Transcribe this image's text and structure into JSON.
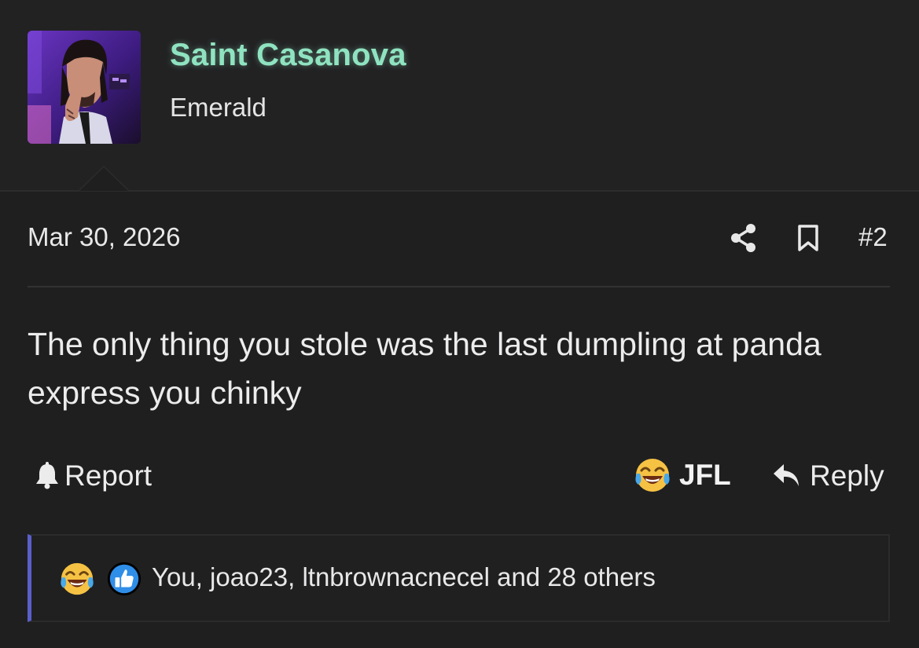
{
  "post": {
    "author": {
      "username": "Saint Casanova",
      "title": "Emerald",
      "username_color": "#8fe3c0"
    },
    "date": "Mar 30, 2026",
    "number": "#2",
    "message": "The only thing you stole was the last dumpling at panda express you chinky",
    "actions": {
      "report_label": "Report",
      "reaction_label": "JFL",
      "reply_label": "Reply"
    },
    "reactions": {
      "icons": [
        "laughing-crying-emoji-icon",
        "thumbs-up-icon"
      ],
      "summary": "You, joao23, ltnbrownacnecel and 28 others"
    }
  },
  "icons": {
    "share": "share-icon",
    "bookmark": "bookmark-icon",
    "report": "bell-icon",
    "reply": "reply-arrow-icon"
  },
  "colors": {
    "background": "#1f1f20",
    "accent_bar": "#5a5fc9"
  }
}
